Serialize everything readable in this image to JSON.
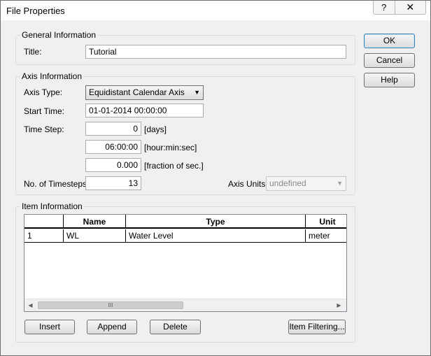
{
  "window": {
    "title": "File Properties",
    "help_glyph": "?",
    "close_glyph": "✕"
  },
  "general": {
    "group_label": "General Information",
    "title_label": "Title:",
    "title_value": "Tutorial"
  },
  "axis": {
    "group_label": "Axis Information",
    "axis_type_label": "Axis Type:",
    "axis_type_value": "Equidistant Calendar Axis",
    "start_time_label": "Start Time:",
    "start_time_value": "01-01-2014 00:00:00",
    "time_step_label": "Time Step:",
    "days_value": "0",
    "days_unit": "[days]",
    "hms_value": "06:00:00",
    "hms_unit": "[hour:min:sec]",
    "fraction_value": "0.000",
    "fraction_unit": "[fraction of sec.]",
    "timesteps_label": "No. of Timesteps:",
    "timesteps_value": "13",
    "units_label": "Axis Units:",
    "units_value": "undefined"
  },
  "items": {
    "group_label": "Item Information",
    "columns": [
      "",
      "Name",
      "Type",
      "Unit"
    ],
    "rows": [
      {
        "index": "1",
        "name": "WL",
        "type": "Water Level",
        "unit": "meter"
      }
    ],
    "scroll_left": "◀",
    "scroll_right": "▶",
    "scroll_grip": "III"
  },
  "buttons": {
    "ok": "OK",
    "cancel": "Cancel",
    "help": "Help",
    "insert": "Insert",
    "append": "Append",
    "delete": "Delete",
    "filtering": "Item Filtering..."
  },
  "icons": {
    "dropdown": "chevron-down-icon",
    "help": "help-icon",
    "close": "close-icon"
  }
}
